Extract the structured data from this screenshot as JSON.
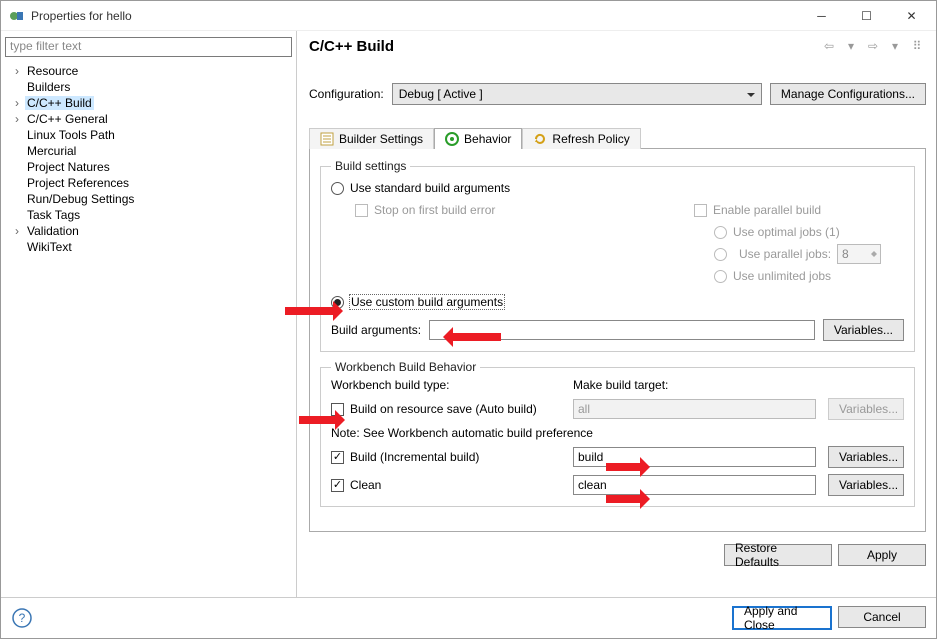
{
  "title": "Properties for hello",
  "filter_placeholder": "type filter text",
  "tree": {
    "resource": "Resource",
    "builders": "Builders",
    "cpp_build": "C/C++ Build",
    "cpp_general": "C/C++ General",
    "linux_tools": "Linux Tools Path",
    "mercurial": "Mercurial",
    "project_natures": "Project Natures",
    "project_refs": "Project References",
    "run_debug": "Run/Debug Settings",
    "task_tags": "Task Tags",
    "validation": "Validation",
    "wikitext": "WikiText"
  },
  "page": {
    "title": "C/C++ Build",
    "config_label": "Configuration:",
    "config_value": "Debug  [ Active ]",
    "manage_cfg": "Manage Configurations..."
  },
  "tabs": {
    "builder": "Builder Settings",
    "behavior": "Behavior",
    "refresh": "Refresh Policy"
  },
  "build_settings": {
    "legend": "Build settings",
    "use_standard": "Use standard build arguments",
    "stop_on_error": "Stop on first build error",
    "enable_parallel": "Enable parallel build",
    "use_optimal": "Use optimal jobs (1)",
    "use_parallel": "Use parallel jobs:",
    "parallel_value": "8",
    "use_unlimited": "Use unlimited jobs",
    "use_custom": "Use custom build arguments",
    "build_args_label": "Build arguments:",
    "variables": "Variables..."
  },
  "workbench": {
    "legend": "Workbench Build Behavior",
    "type_label": "Workbench build type:",
    "target_label": "Make build target:",
    "auto_build": "Build on resource save (Auto build)",
    "auto_target": "all",
    "note": "Note: See Workbench automatic build preference",
    "incremental": "Build (Incremental build)",
    "incremental_target": "build",
    "clean": "Clean",
    "clean_target": "clean",
    "variables": "Variables..."
  },
  "footer": {
    "restore": "Restore Defaults",
    "apply": "Apply",
    "apply_close": "Apply and Close",
    "cancel": "Cancel"
  }
}
